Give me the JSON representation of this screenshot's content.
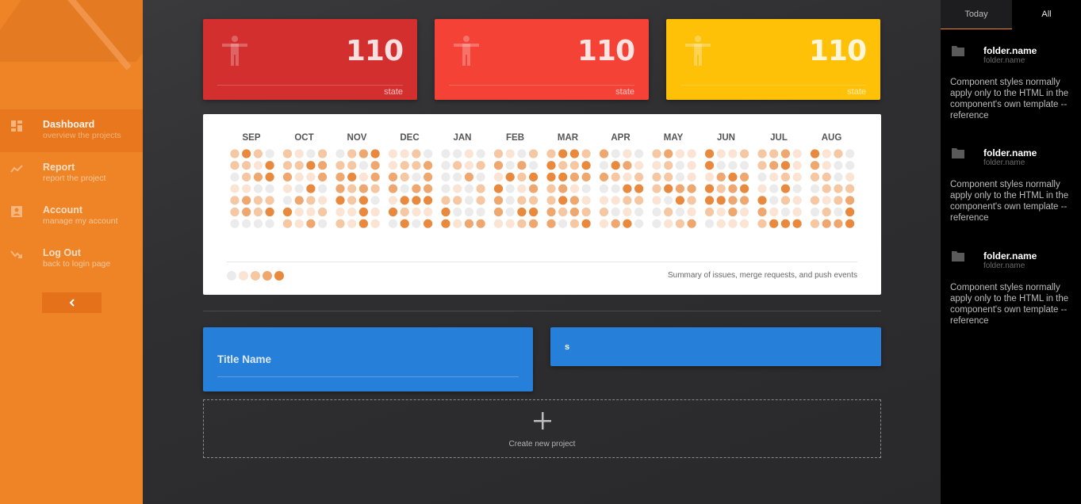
{
  "sidebar": {
    "items": [
      {
        "title": "Dashboard",
        "subtitle": "overview the projects",
        "icon": "dashboard-icon",
        "active": true
      },
      {
        "title": "Report",
        "subtitle": "report the project",
        "icon": "trend-icon",
        "active": false
      },
      {
        "title": "Account",
        "subtitle": "manage my account",
        "icon": "account-icon",
        "active": false
      },
      {
        "title": "Log Out",
        "subtitle": "back to login page",
        "icon": "logout-icon",
        "active": false
      }
    ],
    "collapse_icon": "chevron-left-icon"
  },
  "stats": [
    {
      "value": "110",
      "label": "state",
      "color": "#d32f2f",
      "icon": "accessibility-person-icon"
    },
    {
      "value": "110",
      "label": "state",
      "color": "#f44336",
      "icon": "accessibility-person-icon"
    },
    {
      "value": "110",
      "label": "state",
      "color": "#ffc107",
      "icon": "accessibility-person-icon"
    }
  ],
  "heatmap": {
    "months": [
      "SEP",
      "OCT",
      "NOV",
      "DEC",
      "JAN",
      "FEB",
      "MAR",
      "APR",
      "MAY",
      "JUN",
      "JUL",
      "AUG"
    ],
    "caption": "Summary of issues, merge requests, and push events",
    "legend_colors": [
      "#ebebeb",
      "#fbe4d4",
      "#f5c7a3",
      "#efa770",
      "#e8893d"
    ],
    "weeks_per_month": 4,
    "rows": 7
  },
  "project": {
    "title": "Title Name",
    "input_value": "s",
    "create_label": "Create new project",
    "create_icon": "plus-icon"
  },
  "rpanel": {
    "tabs": {
      "today": "Today",
      "all": "All"
    },
    "items": [
      {
        "name": "folder.name",
        "sub": "folder.name",
        "text": "Component styles normally apply only to the HTML in the component's own template -- reference"
      },
      {
        "name": "folder.name",
        "sub": "folder.name",
        "text": "Component styles normally apply only to the HTML in the component's own template -- reference"
      },
      {
        "name": "folder.name",
        "sub": "folder.name",
        "text": "Component styles normally apply only to the HTML in the component's own template -- reference"
      }
    ]
  },
  "colors": {
    "accent": "#ef8427",
    "blue": "#2680d9"
  }
}
